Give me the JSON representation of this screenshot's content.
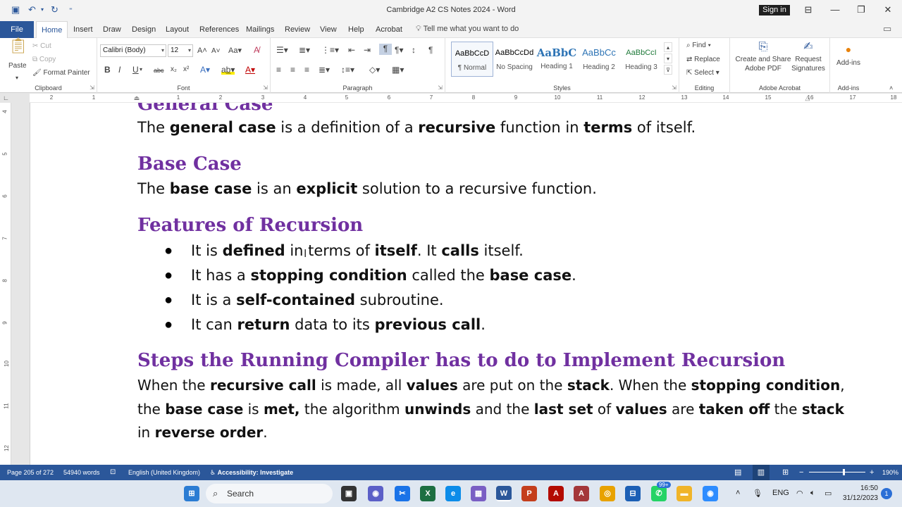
{
  "titlebar": {
    "document_title": "Cambridge A2 CS Notes 2024  -  Word",
    "signin_label": "Sign in",
    "minimize": "—",
    "restore": "❐",
    "close": "✕"
  },
  "menu": {
    "file": "File",
    "tabs": [
      "Home",
      "Insert",
      "Draw",
      "Design",
      "Layout",
      "References",
      "Mailings",
      "Review",
      "View",
      "Help",
      "Acrobat"
    ],
    "tell_me": "Tell me what you want to do"
  },
  "ribbon": {
    "clipboard": {
      "label": "Clipboard",
      "paste": "Paste",
      "cut": "Cut",
      "copy": "Copy",
      "format_painter": "Format Painter"
    },
    "font": {
      "label": "Font",
      "font_name": "Calibri (Body)",
      "font_size": "12"
    },
    "paragraph": {
      "label": "Paragraph"
    },
    "styles": {
      "label": "Styles",
      "items": [
        {
          "sample": "AaBbCcD",
          "name": "¶ Normal"
        },
        {
          "sample": "AaBbCcDd",
          "name": "No Spacing"
        },
        {
          "sample": "AaBbC",
          "name": "Heading 1"
        },
        {
          "sample": "AaBbCc",
          "name": "Heading 2"
        },
        {
          "sample": "AaBbCcI",
          "name": "Heading 3"
        }
      ]
    },
    "editing": {
      "label": "Editing",
      "find": "Find",
      "replace": "Replace",
      "select": "Select"
    },
    "acrobat": {
      "label": "Adobe Acrobat",
      "create_share": "Create and Share",
      "adobe_pdf": "Adobe PDF",
      "request": "Request",
      "signatures": "Signatures"
    },
    "addins": {
      "label": "Add-ins",
      "button": "Add-ins"
    }
  },
  "ruler": {
    "h_numbers": [
      "2",
      "1",
      "1",
      "2",
      "3",
      "4",
      "5",
      "6",
      "7",
      "8",
      "9",
      "10",
      "11",
      "12",
      "13",
      "14",
      "15",
      "16",
      "17",
      "18"
    ],
    "v_numbers": [
      "4",
      "5",
      "6",
      "7",
      "8",
      "9",
      "10",
      "11",
      "12"
    ]
  },
  "document": {
    "top_heading_partial": "General Case",
    "general_case": {
      "t1": "The ",
      "b1": "general case",
      "t2": " is a definition of a ",
      "b2": "recursive",
      "t3": " function in ",
      "b3": "terms",
      "t4": " of itself."
    },
    "base_case_heading": "Base Case",
    "base_case": {
      "t1": "The ",
      "b1": "base case",
      "t2": " is an ",
      "b2": "explicit",
      "t3": " solution to a recursive function."
    },
    "features_heading": "Features of Recursion",
    "bullets": [
      {
        "t1": "It is ",
        "b1": "defined",
        "t2": " in terms of ",
        "b2": "itself",
        "t3": ". It ",
        "b3": "calls",
        "t4": " itself."
      },
      {
        "t1": "It has a ",
        "b1": "stopping condition",
        "t2": " called the ",
        "b2": "base case",
        "t3": "."
      },
      {
        "t1": "It is a ",
        "b1": "self-contained",
        "t2": " subroutine."
      },
      {
        "t1": "It can ",
        "b1": "return",
        "t2": " data to its ",
        "b2": "previous call",
        "t3": "."
      }
    ],
    "steps_heading": "Steps the Running Compiler has to do to Implement Recursion",
    "steps_line1": {
      "t1": "When the ",
      "b1": "recursive call",
      "t2": " is made, all ",
      "b2": "values",
      "t3": " are put on the ",
      "b3": "stack",
      "t4": ". When the ",
      "b4": "stopping condition",
      "t5": ","
    },
    "steps_line2": {
      "t1": "the ",
      "b1": "base case",
      "t2": " is ",
      "b2": "met,",
      "t3": " the algorithm ",
      "b3": "unwinds",
      "t4": " and the ",
      "b4": "last set",
      "t5": " of ",
      "b5": "values",
      "t6": " are ",
      "b6": "taken off",
      "t7": " the ",
      "b7": "stack"
    },
    "steps_line3": {
      "t1": "in ",
      "b1": "reverse order",
      "t2": "."
    }
  },
  "status": {
    "page": "Page 205 of 272",
    "words": "54940 words",
    "language": "English (United Kingdom)",
    "accessibility": "Accessibility: Investigate",
    "zoom": "190%"
  },
  "taskbar": {
    "search": "Search",
    "lang": "ENG",
    "time": "16:50",
    "date": "31/12/2023",
    "notif_badge": "1",
    "whatsapp_badge": "99+"
  },
  "colors": {
    "word_blue": "#2b579a",
    "heading_purple": "#7030a0"
  }
}
